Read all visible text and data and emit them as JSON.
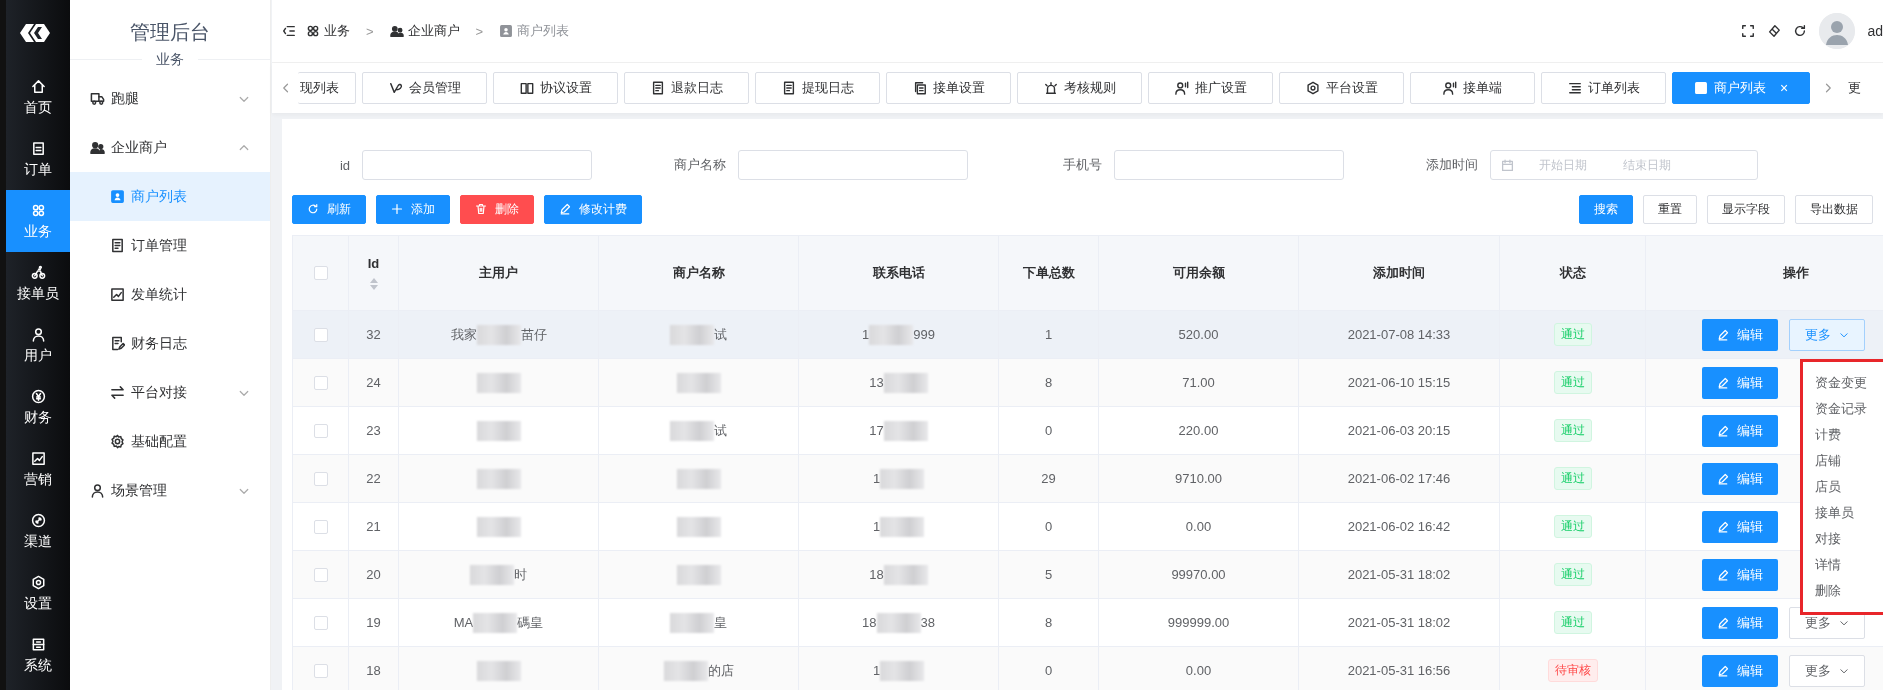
{
  "rail": {
    "items": [
      {
        "label": "首页",
        "selected": false
      },
      {
        "label": "订单",
        "selected": false
      },
      {
        "label": "业务",
        "selected": true
      },
      {
        "label": "接单员",
        "selected": false
      },
      {
        "label": "用户",
        "selected": false
      },
      {
        "label": "财务",
        "selected": false
      },
      {
        "label": "营销",
        "selected": false
      },
      {
        "label": "渠道",
        "selected": false
      },
      {
        "label": "设置",
        "selected": false
      },
      {
        "label": "系统",
        "selected": false
      }
    ]
  },
  "sidebar": {
    "title": "管理后台",
    "subtitle": "业务",
    "items": [
      {
        "label": "跑腿",
        "selected": false,
        "expanded": false
      },
      {
        "label": "企业商户",
        "selected": false,
        "expanded": true,
        "children": [
          {
            "label": "商户列表",
            "selected": true
          },
          {
            "label": "订单管理",
            "selected": false
          },
          {
            "label": "发单统计",
            "selected": false
          },
          {
            "label": "财务日志",
            "selected": false
          },
          {
            "label": "平台对接",
            "selected": false,
            "expanded": false
          },
          {
            "label": "基础配置",
            "selected": false
          }
        ]
      },
      {
        "label": "场景管理",
        "selected": false,
        "expanded": false
      }
    ]
  },
  "breadcrumb": {
    "separator": ">",
    "items": [
      "业务",
      "企业商户",
      "商户列表"
    ]
  },
  "header": {
    "user": "ad"
  },
  "tabs": {
    "items": [
      {
        "label": "现列表",
        "selected": false
      },
      {
        "label": "会员管理",
        "selected": false
      },
      {
        "label": "协议设置",
        "selected": false
      },
      {
        "label": "退款日志",
        "selected": false
      },
      {
        "label": "提现日志",
        "selected": false
      },
      {
        "label": "接单设置",
        "selected": false
      },
      {
        "label": "考核规则",
        "selected": false
      },
      {
        "label": "推广设置",
        "selected": false
      },
      {
        "label": "平台设置",
        "selected": false
      },
      {
        "label": "接单端",
        "selected": false
      },
      {
        "label": "订单列表",
        "selected": false
      },
      {
        "label": "商户列表",
        "selected": true,
        "close": "×"
      }
    ],
    "more": "更"
  },
  "filters": [
    {
      "label": "id",
      "kind": "text"
    },
    {
      "label": "商户名称",
      "kind": "text"
    },
    {
      "label": "手机号",
      "kind": "text"
    },
    {
      "label": "添加时间",
      "kind": "daterange",
      "start_placeholder": "开始日期",
      "end_placeholder": "结束日期"
    }
  ],
  "actions": [
    {
      "label": "刷新",
      "kind": "primary"
    },
    {
      "label": "添加",
      "kind": "primary"
    },
    {
      "label": "删除",
      "kind": "danger"
    },
    {
      "label": "修改计费",
      "kind": "primary"
    }
  ],
  "tools": [
    {
      "label": "搜索",
      "kind": "primary"
    },
    {
      "label": "重置",
      "kind": "plain"
    },
    {
      "label": "显示字段",
      "kind": "plain"
    },
    {
      "label": "导出数据",
      "kind": "plain"
    }
  ],
  "table": {
    "select_all": {
      "checked": false
    },
    "columns": [
      {
        "label": "Id",
        "sortable": true
      },
      {
        "label": "主用户"
      },
      {
        "label": "商户名称"
      },
      {
        "label": "联系电话"
      },
      {
        "label": "下单总数"
      },
      {
        "label": "可用余额"
      },
      {
        "label": "添加时间"
      },
      {
        "label": "状态"
      },
      {
        "label": "操作"
      }
    ],
    "rows": [
      {
        "checked": false,
        "hover": true,
        "id": "32",
        "user": [
          {
            "kind": "text",
            "text": "我家"
          },
          {
            "kind": "redacted"
          },
          {
            "kind": "text",
            "text": "苗仔"
          }
        ],
        "merchant": [
          {
            "kind": "redacted"
          },
          {
            "kind": "text",
            "text": "试"
          }
        ],
        "phone": [
          {
            "kind": "text",
            "text": "1"
          },
          {
            "kind": "redacted"
          },
          {
            "kind": "text",
            "text": "999"
          }
        ],
        "orders": "1",
        "balance": "520.00",
        "added": "2021-07-08 14:33",
        "status": {
          "text": "通过",
          "kind": "approved"
        },
        "edit": "编辑",
        "more": {
          "label": "更多",
          "open": true
        }
      },
      {
        "checked": false,
        "hover": false,
        "id": "24",
        "user": [
          {
            "kind": "redacted"
          }
        ],
        "merchant": [
          {
            "kind": "redacted"
          }
        ],
        "phone": [
          {
            "kind": "text",
            "text": "13"
          },
          {
            "kind": "redacted"
          }
        ],
        "orders": "8",
        "balance": "71.00",
        "added": "2021-06-10 15:15",
        "status": {
          "text": "通过",
          "kind": "approved"
        },
        "edit": "编辑"
      },
      {
        "checked": false,
        "hover": false,
        "id": "23",
        "user": [
          {
            "kind": "redacted"
          }
        ],
        "merchant": [
          {
            "kind": "redacted"
          },
          {
            "kind": "text",
            "text": "试"
          }
        ],
        "phone": [
          {
            "kind": "text",
            "text": "17"
          },
          {
            "kind": "redacted"
          }
        ],
        "orders": "0",
        "balance": "220.00",
        "added": "2021-06-03 20:15",
        "status": {
          "text": "通过",
          "kind": "approved"
        },
        "edit": "编辑"
      },
      {
        "checked": false,
        "hover": false,
        "id": "22",
        "user": [
          {
            "kind": "redacted"
          }
        ],
        "merchant": [
          {
            "kind": "redacted"
          }
        ],
        "phone": [
          {
            "kind": "text",
            "text": "1"
          },
          {
            "kind": "redacted"
          }
        ],
        "orders": "29",
        "balance": "9710.00",
        "added": "2021-06-02 17:46",
        "status": {
          "text": "通过",
          "kind": "approved"
        },
        "edit": "编辑"
      },
      {
        "checked": false,
        "hover": false,
        "id": "21",
        "user": [
          {
            "kind": "redacted"
          }
        ],
        "merchant": [
          {
            "kind": "redacted"
          }
        ],
        "phone": [
          {
            "kind": "text",
            "text": "1"
          },
          {
            "kind": "redacted"
          }
        ],
        "orders": "0",
        "balance": "0.00",
        "added": "2021-06-02 16:42",
        "status": {
          "text": "通过",
          "kind": "approved"
        },
        "edit": "编辑"
      },
      {
        "checked": false,
        "hover": false,
        "id": "20",
        "user": [
          {
            "kind": "redacted"
          },
          {
            "kind": "text",
            "text": "时"
          }
        ],
        "merchant": [
          {
            "kind": "redacted"
          }
        ],
        "phone": [
          {
            "kind": "text",
            "text": "18"
          },
          {
            "kind": "redacted"
          }
        ],
        "orders": "5",
        "balance": "99970.00",
        "added": "2021-05-31 18:02",
        "status": {
          "text": "通过",
          "kind": "approved"
        },
        "edit": "编辑"
      },
      {
        "checked": false,
        "hover": false,
        "id": "19",
        "user": [
          {
            "kind": "text",
            "text": "MA"
          },
          {
            "kind": "redacted"
          },
          {
            "kind": "text",
            "text": "碼皇"
          }
        ],
        "merchant": [
          {
            "kind": "redacted"
          },
          {
            "kind": "text",
            "text": "皇"
          }
        ],
        "phone": [
          {
            "kind": "text",
            "text": "18"
          },
          {
            "kind": "redacted"
          },
          {
            "kind": "text",
            "text": "38"
          }
        ],
        "orders": "8",
        "balance": "999999.00",
        "added": "2021-05-31 18:02",
        "status": {
          "text": "通过",
          "kind": "approved"
        },
        "edit": "编辑",
        "more": {
          "label": "更多",
          "open": false
        }
      },
      {
        "checked": false,
        "hover": false,
        "id": "18",
        "user": [
          {
            "kind": "redacted"
          }
        ],
        "merchant": [
          {
            "kind": "redacted"
          },
          {
            "kind": "text",
            "text": "的店"
          }
        ],
        "phone": [
          {
            "kind": "text",
            "text": "1"
          },
          {
            "kind": "redacted"
          }
        ],
        "orders": "0",
        "balance": "0.00",
        "added": "2021-05-31 16:56",
        "status": {
          "text": "待审核",
          "kind": "pending"
        },
        "edit": "编辑",
        "more": {
          "label": "更多",
          "open": false
        }
      }
    ]
  },
  "dropdown": {
    "items": [
      "资金变更",
      "资金记录",
      "计费",
      "店铺",
      "店员",
      "接单员",
      "对接",
      "详情",
      "删除"
    ]
  }
}
